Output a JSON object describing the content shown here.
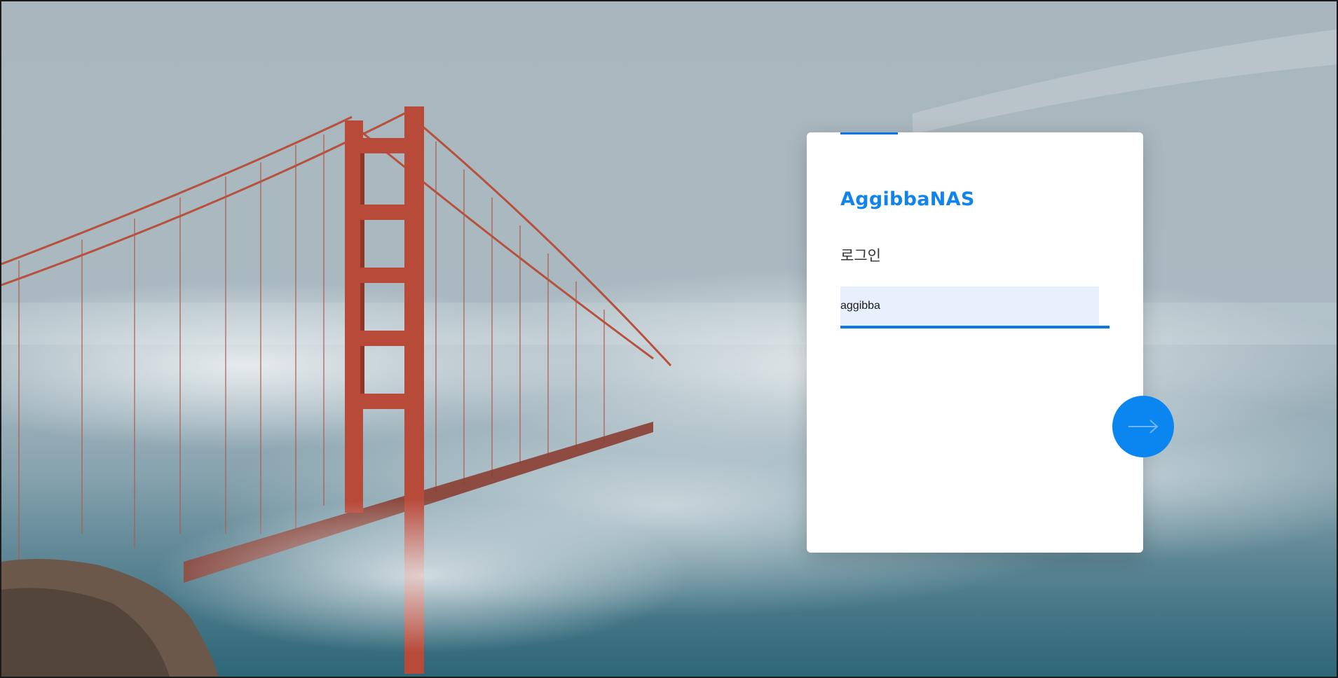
{
  "login": {
    "brand": "AggibbaNAS",
    "heading": "로그인",
    "username_value": "aggibba"
  },
  "icons": {
    "next": "arrow-right-icon"
  },
  "colors": {
    "accent": "#0b78e8",
    "brand_text": "#1184ec",
    "input_background": "#e8f0fd",
    "next_button": "#0b86f0"
  }
}
